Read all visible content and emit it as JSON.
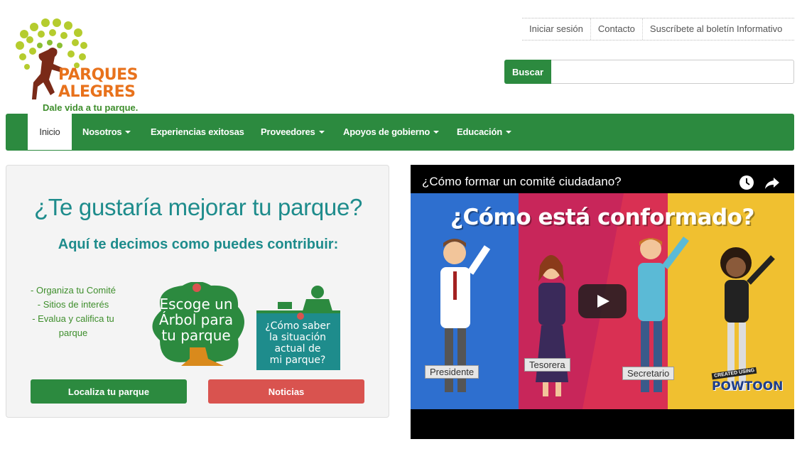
{
  "logo": {
    "title_line1": "PARQUES",
    "title_line2": "ALEGRES",
    "tagline": "Dale vida a tu parque."
  },
  "toplinks": [
    "Iniciar sesión",
    "Contacto",
    "Suscríbete al boletín Informativo"
  ],
  "search": {
    "button_label": "Buscar",
    "placeholder": ""
  },
  "nav": {
    "items": [
      {
        "label": "Inicio",
        "active": true,
        "dropdown": false
      },
      {
        "label": "Nosotros",
        "active": false,
        "dropdown": true
      },
      {
        "label": "Experiencias exitosas",
        "active": false,
        "dropdown": false
      },
      {
        "label": "Proveedores",
        "active": false,
        "dropdown": true
      },
      {
        "label": "Apoyos de gobierno",
        "active": false,
        "dropdown": true
      },
      {
        "label": "Educación",
        "active": false,
        "dropdown": true
      }
    ]
  },
  "panel": {
    "title": "¿Te gustaría mejorar tu parque?",
    "subtitle": "Aquí te decimos como puedes contribuir:",
    "list": [
      "- Organiza tu Comité",
      "- Sitios de interés",
      "- Evalua y califica tu",
      "parque"
    ],
    "tree_card_text": [
      "Escoge un",
      "Árbol para",
      "tu parque"
    ],
    "book_card_text": [
      "¿Cómo saber",
      "la situación",
      "actual de",
      "mi parque?"
    ],
    "btn_localiza": "Localiza tu parque",
    "btn_noticias": "Noticias"
  },
  "video": {
    "title": "¿Cómo formar un comité ciudadano?",
    "headline": "¿Cómo está conformado?",
    "roles": [
      "Presidente",
      "Tesorera",
      "Secretario"
    ],
    "powtoon_top": "CREATED USING",
    "powtoon_brand": "POWTOON",
    "panel_colors": [
      "#2e6fcf",
      "#c8265a",
      "#e8384f",
      "#f0c030"
    ]
  },
  "colors": {
    "brand_green": "#2c8a3f",
    "teal": "#1e8c8c",
    "red": "#d9534f",
    "orange": "#e8721c"
  }
}
